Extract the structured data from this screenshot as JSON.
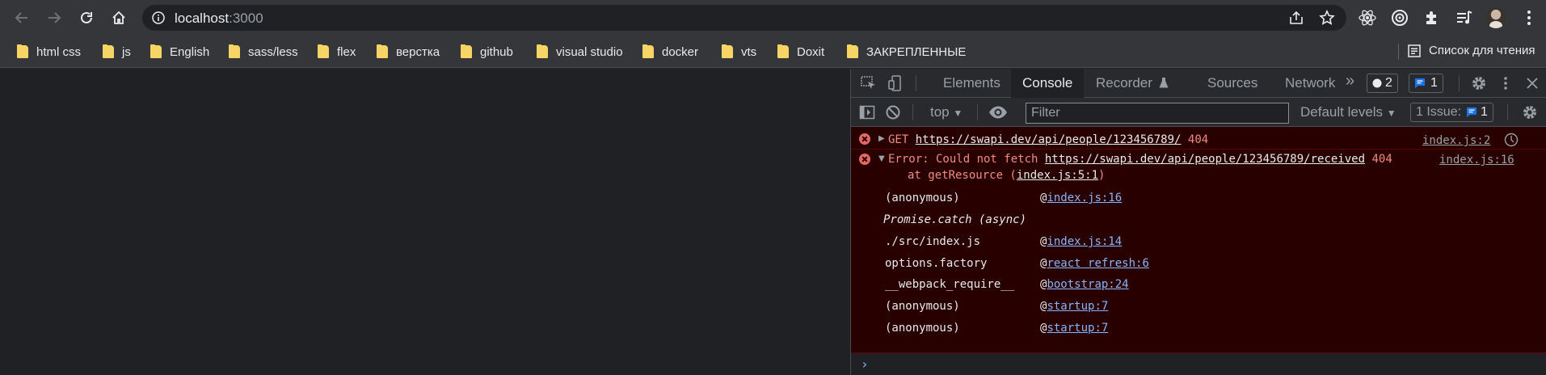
{
  "browser": {
    "url_host": "localhost",
    "url_port": ":3000"
  },
  "bookmarks": [
    {
      "label": "html css"
    },
    {
      "label": "js"
    },
    {
      "label": "English"
    },
    {
      "label": "sass/less"
    },
    {
      "label": "flex"
    },
    {
      "label": "верстка"
    },
    {
      "label": "github"
    },
    {
      "label": "visual studio"
    },
    {
      "label": "docker"
    },
    {
      "label": "vts"
    },
    {
      "label": "Doxit"
    },
    {
      "label": "ЗАКРЕПЛЕННЫЕ"
    }
  ],
  "reading_list": "Список для чтения",
  "devtools": {
    "tabs": [
      "Elements",
      "Console",
      "Recorder",
      "Sources",
      "Network"
    ],
    "active_tab": "Console",
    "error_count": "2",
    "message_count": "1",
    "context": "top",
    "filter_placeholder": "Filter",
    "levels": "Default levels",
    "issues_label": "1 Issue:",
    "issues_count": "1"
  },
  "console": {
    "msg1": {
      "method": "GET",
      "url": "https://swapi.dev/api/people/123456789/",
      "status": "404",
      "source": "index.js:2"
    },
    "msg2": {
      "prefix": "Error: Could not fetch",
      "url": "https://swapi.dev/api/people/123456789/received",
      "status": "404",
      "source": "index.js:16",
      "at_prefix": "at getResource (",
      "at_loc": "index.js:5:1",
      "at_suffix": ")",
      "stack": [
        {
          "fn": "(anonymous)",
          "loc": "index.js:16"
        },
        {
          "fn": "./src/index.js",
          "loc": "index.js:14"
        },
        {
          "fn": "options.factory",
          "loc": "react refresh:6"
        },
        {
          "fn": "__webpack_require__",
          "loc": "bootstrap:24"
        },
        {
          "fn": "(anonymous)",
          "loc": "startup:7"
        },
        {
          "fn": "(anonymous)",
          "loc": "startup:7"
        }
      ],
      "async_label": "Promise.catch (async)"
    }
  },
  "colors": {
    "error_bg": "#290000",
    "error_text": "#f28b82",
    "link_blue": "#8ab4f8",
    "folder": "#f7d564"
  },
  "icons": [
    "back-arrow-icon",
    "forward-arrow-icon",
    "reload-icon",
    "home-icon",
    "info-icon",
    "share-icon",
    "star-icon",
    "react-icon",
    "extension-circle-icon",
    "puzzle-icon",
    "media-icon",
    "kebab-menu-icon",
    "folder-icon",
    "reading-list-icon",
    "inspect-icon",
    "device-toggle-icon",
    "flask-icon",
    "settings-icon",
    "close-icon",
    "sidebar-icon",
    "clear-icon",
    "eye-icon",
    "error-icon",
    "message-icon",
    "performance-icon"
  ]
}
